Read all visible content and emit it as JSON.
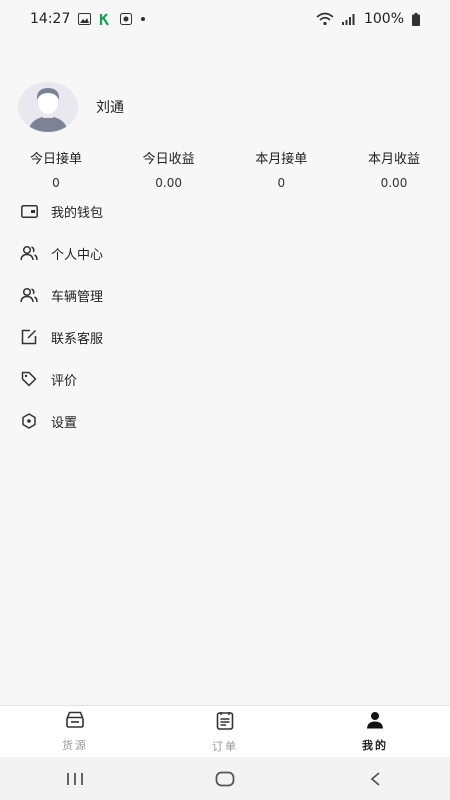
{
  "status_bar": {
    "time": "14:27",
    "battery": "100%"
  },
  "profile": {
    "name": "刘通"
  },
  "stats": [
    {
      "label": "今日接单",
      "value": "0"
    },
    {
      "label": "今日收益",
      "value": "0.00"
    },
    {
      "label": "本月接单",
      "value": "0"
    },
    {
      "label": "本月收益",
      "value": "0.00"
    }
  ],
  "menu": [
    {
      "label": "我的钱包",
      "icon": "wallet-icon"
    },
    {
      "label": "个人中心",
      "icon": "users-icon"
    },
    {
      "label": "车辆管理",
      "icon": "users-icon"
    },
    {
      "label": "联系客服",
      "icon": "edit-icon"
    },
    {
      "label": "评价",
      "icon": "tag-icon"
    },
    {
      "label": "设置",
      "icon": "settings-icon"
    }
  ],
  "tabs": [
    {
      "label": "货源",
      "icon": "cargo-icon",
      "active": false
    },
    {
      "label": "订单",
      "icon": "order-icon",
      "active": false
    },
    {
      "label": "我的",
      "icon": "person-icon",
      "active": true
    }
  ]
}
